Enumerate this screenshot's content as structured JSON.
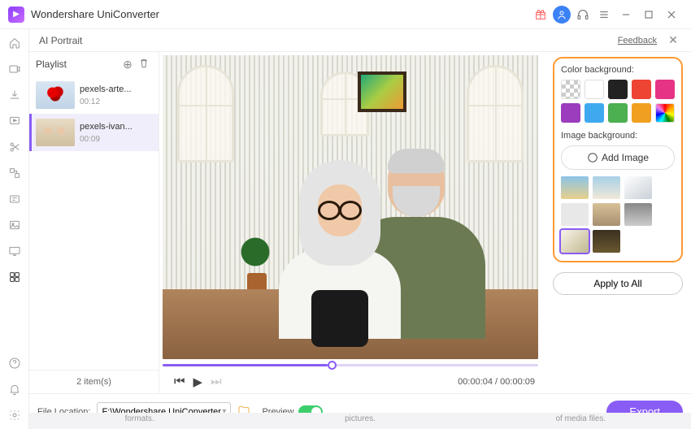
{
  "app": {
    "name": "Wondershare UniConverter"
  },
  "panel": {
    "title": "AI Portrait",
    "feedback": "Feedback"
  },
  "playlist": {
    "title": "Playlist",
    "items": [
      {
        "name": "pexels-arte...",
        "time": "00:12"
      },
      {
        "name": "pexels-ivan...",
        "time": "00:09"
      }
    ],
    "footer_count": "2 item(s)"
  },
  "preview": {
    "current": "00:00:04",
    "total": "00:00:09"
  },
  "right": {
    "color_label": "Color background:",
    "image_label": "Image background:",
    "add_image": "Add Image",
    "apply_all": "Apply to All"
  },
  "bottom": {
    "file_location_label": "File Location:",
    "file_location_value": "F:\\Wondershare UniConverter",
    "preview_label": "Preview",
    "export": "Export"
  },
  "hints": {
    "a": "formats.",
    "b": "pictures.",
    "c": "of media files."
  }
}
